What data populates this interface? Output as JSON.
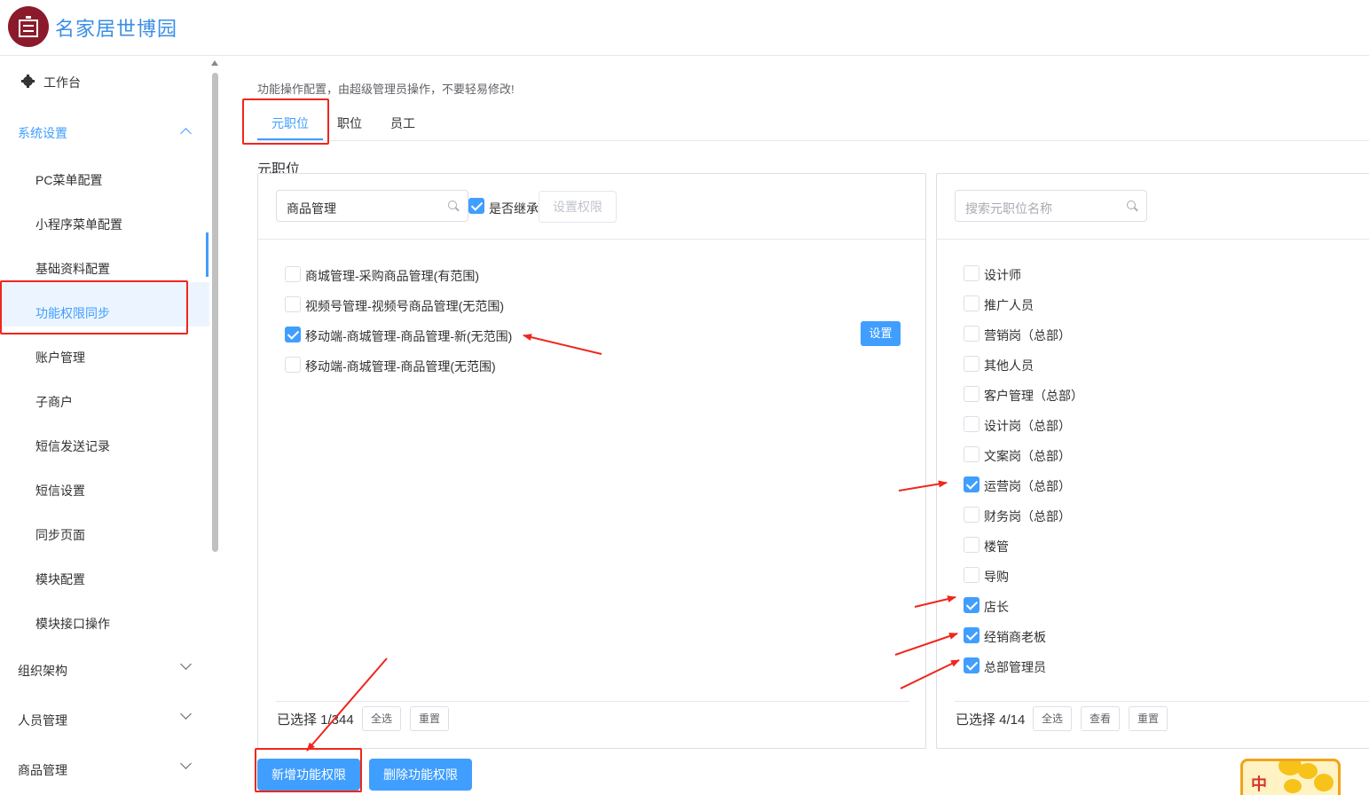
{
  "app": {
    "title": "名家居世博园"
  },
  "sidebar": {
    "top_item": "工作台",
    "group_expanded": "系统设置",
    "sub_items": [
      "PC菜单配置",
      "小程序菜单配置",
      "基础资料配置",
      "功能权限同步",
      "账户管理",
      "子商户",
      "短信发送记录",
      "短信设置",
      "同步页面",
      "模块配置",
      "模块接口操作"
    ],
    "selected_item": "功能权限同步",
    "collapsed_groups": [
      "组织架构",
      "人员管理",
      "商品管理"
    ]
  },
  "main": {
    "notice": "功能操作配置，由超级管理员操作，不要轻易修改!",
    "tabs": [
      "元职位",
      "职位",
      "员工"
    ],
    "active_tab": "元职位",
    "section_title": "元职位"
  },
  "left_panel": {
    "search_value": "商品管理",
    "inherit_label": "是否继承",
    "inherit_checked": true,
    "set_permission_button": "设置权限",
    "items": [
      {
        "label": "商城管理-采购商品管理(有范围)",
        "checked": false
      },
      {
        "label": "视频号管理-视频号商品管理(无范围)",
        "checked": false
      },
      {
        "label": "移动端-商城管理-商品管理-新(无范围)",
        "checked": true
      },
      {
        "label": "移动端-商城管理-商品管理(无范围)",
        "checked": false
      }
    ],
    "row_action_button": "设置",
    "selected_summary": "已选择 1/344",
    "select_all_button": "全选",
    "reset_button": "重置"
  },
  "right_panel": {
    "search_placeholder": "搜索元职位名称",
    "items": [
      {
        "label": "设计师",
        "checked": false
      },
      {
        "label": "推广人员",
        "checked": false
      },
      {
        "label": "营销岗（总部）",
        "checked": false
      },
      {
        "label": "其他人员",
        "checked": false
      },
      {
        "label": "客户管理（总部）",
        "checked": false
      },
      {
        "label": "设计岗（总部）",
        "checked": false
      },
      {
        "label": "文案岗（总部）",
        "checked": false
      },
      {
        "label": "运营岗（总部）",
        "checked": true
      },
      {
        "label": "财务岗（总部）",
        "checked": false
      },
      {
        "label": "楼管",
        "checked": false
      },
      {
        "label": "导购",
        "checked": false
      },
      {
        "label": "店长",
        "checked": true
      },
      {
        "label": "经销商老板",
        "checked": true
      },
      {
        "label": "总部管理员",
        "checked": true
      }
    ],
    "selected_summary": "已选择 4/14",
    "select_all_button": "全选",
    "view_button": "查看",
    "reset_button": "重置"
  },
  "actions": {
    "add_permission": "新增功能权限",
    "delete_permission": "删除功能权限"
  },
  "widget": {
    "text": "中"
  },
  "colors": {
    "primary": "#409eff",
    "annotation_red": "#f0261c",
    "logo": "#8b1a2b"
  }
}
